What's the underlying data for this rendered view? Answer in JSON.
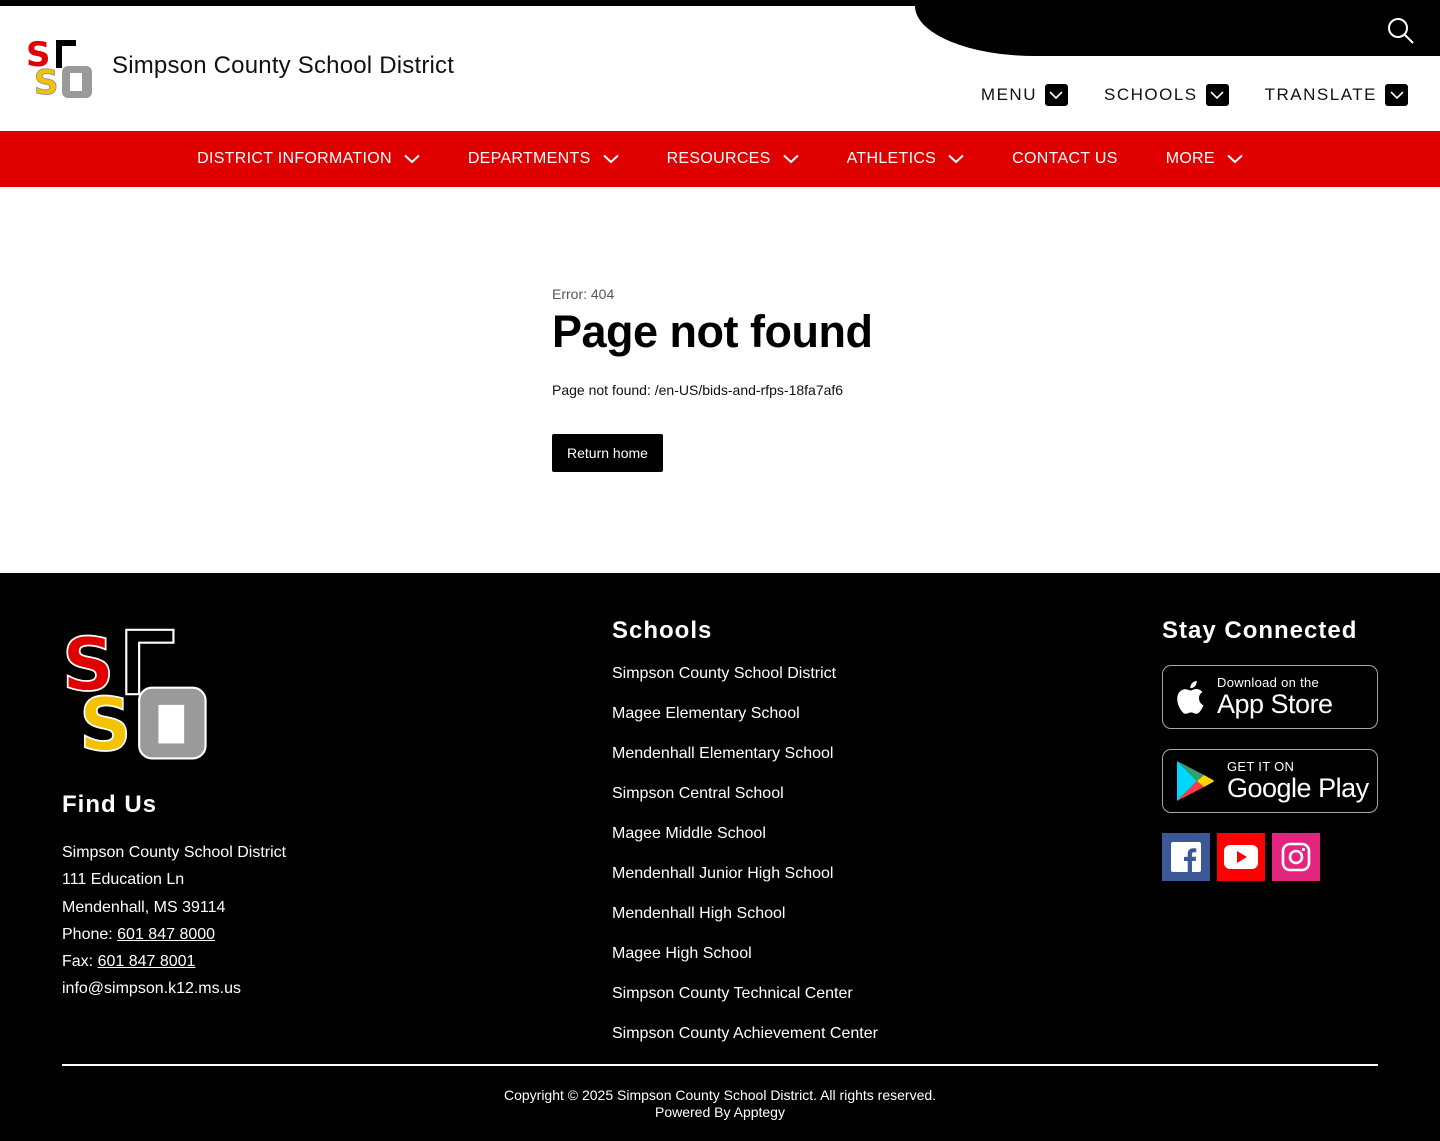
{
  "header": {
    "site_title": "Simpson County School District",
    "top_links": [
      {
        "label": "MENU"
      },
      {
        "label": "SCHOOLS"
      },
      {
        "label": "TRANSLATE"
      }
    ]
  },
  "nav": {
    "items": [
      {
        "label": "DISTRICT INFORMATION",
        "has_dropdown": true
      },
      {
        "label": "DEPARTMENTS",
        "has_dropdown": true
      },
      {
        "label": "RESOURCES",
        "has_dropdown": true
      },
      {
        "label": "ATHLETICS",
        "has_dropdown": true
      },
      {
        "label": "CONTACT US",
        "has_dropdown": false
      },
      {
        "label": "MORE",
        "has_dropdown": true
      }
    ]
  },
  "main": {
    "error_code": "Error: 404",
    "title": "Page not found",
    "message": "Page not found: /en-US/bids-and-rfps-18fa7af6",
    "return_button": "Return home"
  },
  "footer": {
    "find_us": {
      "title": "Find Us",
      "name": "Simpson County School District",
      "street": "111 Education Ln",
      "city": "Mendenhall, MS 39114",
      "phone_label": "Phone: ",
      "phone": "601 847 8000",
      "fax_label": "Fax: ",
      "fax": "601 847 8001",
      "email": "info@simpson.k12.ms.us"
    },
    "schools": {
      "title": "Schools",
      "items": [
        "Simpson County School District",
        "Magee Elementary School",
        "Mendenhall Elementary School",
        "Simpson Central School",
        "Magee Middle School",
        "Mendenhall Junior High School",
        "Mendenhall High School",
        "Magee High School",
        "Simpson County Technical Center",
        "Simpson County Achievement Center"
      ]
    },
    "stay_connected": {
      "title": "Stay Connected",
      "app_store": {
        "small": "Download on the",
        "big": "App Store"
      },
      "google_play": {
        "small": "GET IT ON",
        "big": "Google Play"
      },
      "social": [
        {
          "icon": "facebook-icon",
          "color": "#3b5998"
        },
        {
          "icon": "youtube-icon",
          "color": "#ff0000"
        },
        {
          "icon": "instagram-icon",
          "color": "#e4257f"
        }
      ]
    },
    "copyright": "Copyright © 2025 Simpson County School District. All rights reserved.",
    "powered_by": "Powered By Apptegy"
  },
  "colors": {
    "brand_red": "#e10000",
    "logo_yellow": "#f3c300",
    "logo_gray": "#9a9a9a"
  }
}
